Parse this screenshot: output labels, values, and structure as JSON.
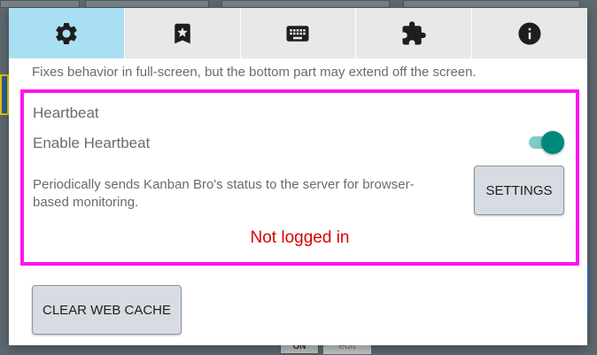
{
  "tabs": [
    {
      "icon": "gear-icon",
      "active": true
    },
    {
      "icon": "bookmark-star-icon",
      "active": false
    },
    {
      "icon": "keyboard-icon",
      "active": false
    },
    {
      "icon": "puzzle-piece-icon",
      "active": false
    },
    {
      "icon": "info-icon",
      "active": false
    }
  ],
  "fullscreen_note": "Fixes behavior in full-screen, but the bottom part may extend off the screen.",
  "heartbeat": {
    "title": "Heartbeat",
    "enable_label": "Enable Heartbeat",
    "enabled": true,
    "description": "Periodically sends Kanban Bro's status to the server for browser-based monitoring.",
    "settings_label": "SETTINGS",
    "status": "Not logged in",
    "status_color": "#dd0000",
    "highlight_color": "#ff14f0"
  },
  "clear_cache_label": "CLEAR WEB CACHE",
  "background": {
    "chip_on": "ON",
    "chip_edit": "edit"
  },
  "colors": {
    "active_tab": "#a9dff2",
    "toggle_knob": "#00897b",
    "toggle_track": "#80cbc4"
  }
}
